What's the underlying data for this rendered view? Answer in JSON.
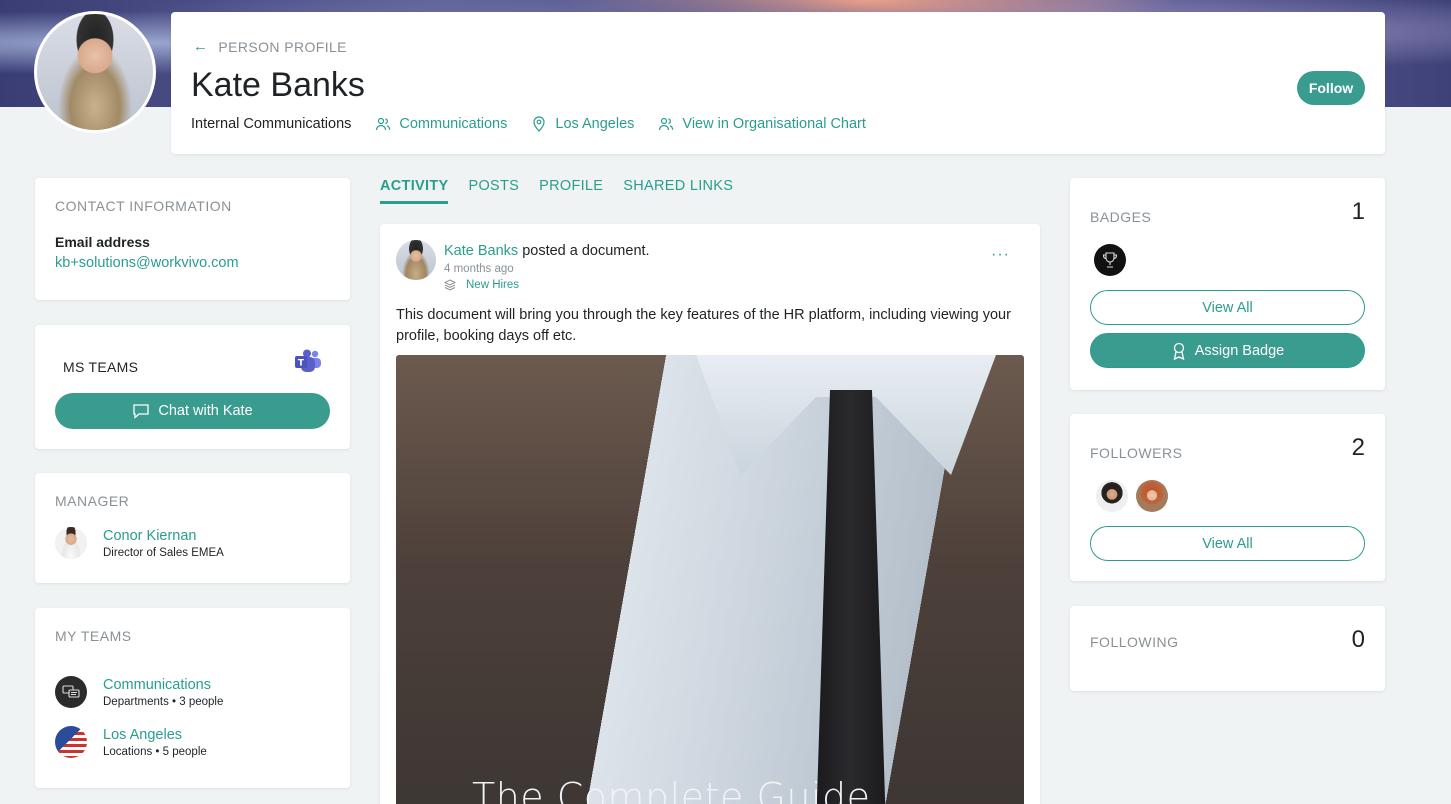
{
  "colors": {
    "accent": "#3a9c8e",
    "link": "#2a9d8f",
    "muted": "#8a9196",
    "background": "#f0f3f3"
  },
  "header": {
    "back_label": "PERSON PROFILE",
    "name": "Kate Banks",
    "role": "Internal Communications",
    "department": "Communications",
    "location": "Los Angeles",
    "org_chart_link": "View in Organisational Chart",
    "follow_label": "Follow"
  },
  "contact": {
    "title": "CONTACT INFORMATION",
    "email_label": "Email address",
    "email": "kb+solutions@workvivo.com"
  },
  "ms_teams": {
    "title": "MS TEAMS",
    "chat_label": "Chat with Kate"
  },
  "manager": {
    "title": "MANAGER",
    "name": "Conor Kiernan",
    "job": "Director of Sales EMEA"
  },
  "my_teams": {
    "title": "MY TEAMS",
    "items": [
      {
        "name": "Communications",
        "sub": "Departments • 3 people"
      },
      {
        "name": "Los Angeles",
        "sub": "Locations • 5 people"
      }
    ]
  },
  "tabs": [
    "ACTIVITY",
    "POSTS",
    "PROFILE",
    "SHARED LINKS"
  ],
  "post": {
    "author": "Kate Banks",
    "action": " posted a document.",
    "time": "4 months ago",
    "space": "New Hires",
    "body": "This document will bring you through the key features of the HR platform, including viewing your profile, booking days off etc.",
    "image_caption": "The Complete Guide",
    "more": "···"
  },
  "badges": {
    "title": "BADGES",
    "count": "1",
    "view_all": "View All",
    "assign": "Assign Badge"
  },
  "followers": {
    "title": "FOLLOWERS",
    "count": "2",
    "view_all": "View All"
  },
  "following": {
    "title": "FOLLOWING",
    "count": "0"
  }
}
